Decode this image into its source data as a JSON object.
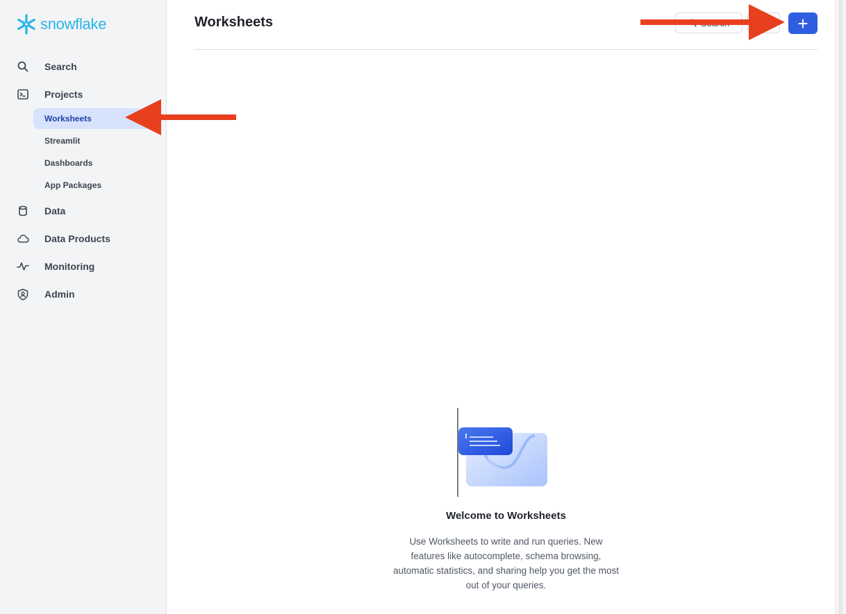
{
  "brand": {
    "name": "snowflake",
    "color": "#29b5e8"
  },
  "sidebar": {
    "items": [
      {
        "label": "Search",
        "icon": "search-icon"
      },
      {
        "label": "Projects",
        "icon": "terminal-icon"
      },
      {
        "label": "Data",
        "icon": "database-icon"
      },
      {
        "label": "Data Products",
        "icon": "cloud-icon"
      },
      {
        "label": "Monitoring",
        "icon": "activity-icon"
      },
      {
        "label": "Admin",
        "icon": "shield-icon"
      }
    ],
    "project_subitems": [
      {
        "label": "Worksheets",
        "active": true
      },
      {
        "label": "Streamlit"
      },
      {
        "label": "Dashboards"
      },
      {
        "label": "App Packages"
      }
    ]
  },
  "header": {
    "title": "Worksheets",
    "search_label": "Search",
    "add_label": "+"
  },
  "empty_state": {
    "title": "Welcome to Worksheets",
    "body": "Use Worksheets to write and run queries. New features like autocomplete, schema browsing, automatic statistics, and sharing help you get the most out of your queries."
  },
  "colors": {
    "accent": "#2f5ee0",
    "active_nav_bg": "#d7e3fc",
    "annotation_arrow": "#e8401f"
  }
}
